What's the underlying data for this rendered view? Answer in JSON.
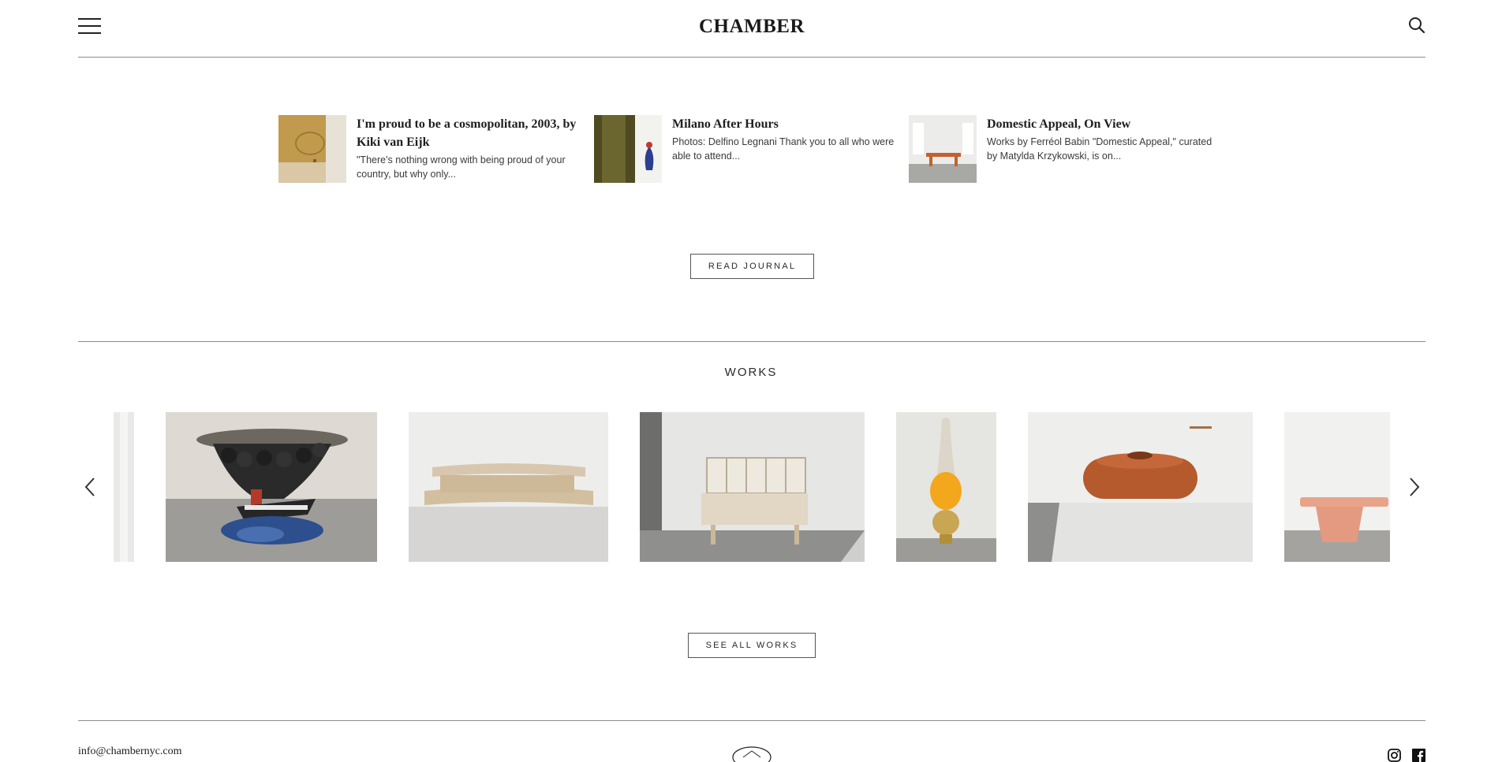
{
  "header": {
    "logo": "CHAMBER",
    "menu_icon": "hamburger-menu-icon",
    "search_icon": "search-icon"
  },
  "journal": {
    "items": [
      {
        "title": "I'm proud to be a cosmopolitan, 2003, by Kiki van Eijk",
        "excerpt": "\"There's nothing wrong with being proud of your country, but why only..."
      },
      {
        "title": "Milano After Hours",
        "excerpt": "Photos: Delfino Legnani Thank you to all who were able to attend..."
      },
      {
        "title": "Domestic Appeal, On View",
        "excerpt": "Works by Ferréol Babin \"Domestic Appeal,\" curated by Matylda Krzykowski, is on..."
      }
    ],
    "button_label": "READ JOURNAL"
  },
  "works": {
    "title": "WORKS",
    "prev_icon": "chevron-left-icon",
    "next_icon": "chevron-right-icon",
    "button_label": "SEE ALL WORKS"
  },
  "footer": {
    "email": "info@chambernyc.com",
    "emblem_icon": "chamber-emblem-icon",
    "instagram_icon": "instagram-icon",
    "facebook_icon": "facebook-icon"
  },
  "colors": {
    "text": "#222222",
    "divider": "#8a8a8a",
    "background": "#ffffff"
  }
}
